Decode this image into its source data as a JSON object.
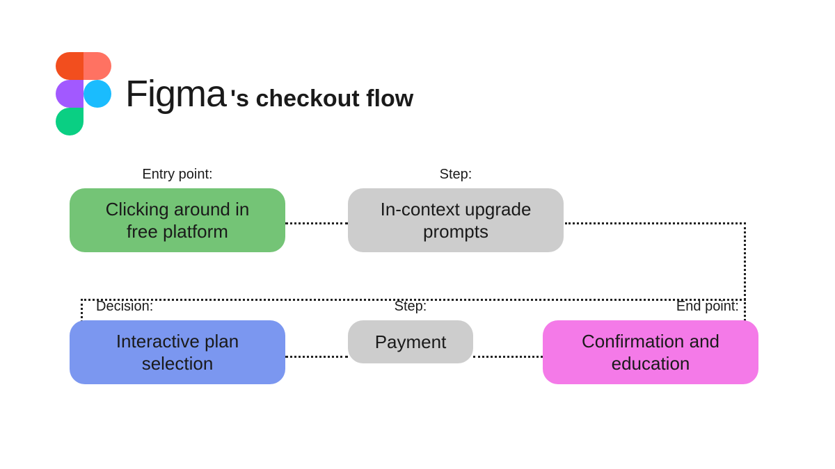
{
  "header": {
    "brand": "Figma",
    "title_suffix": "'s checkout flow"
  },
  "nodes": {
    "entry": {
      "label": "Entry point:",
      "text": "Clicking around in free platform",
      "color": "#74C476"
    },
    "step1": {
      "label": "Step:",
      "text": "In-context upgrade prompts",
      "color": "#CDCDCD"
    },
    "decision": {
      "label": "Decision:",
      "text": "Interactive plan selection",
      "color": "#7B97F0"
    },
    "step2": {
      "label": "Step:",
      "text": "Payment",
      "color": "#CDCDCD"
    },
    "end": {
      "label": "End point:",
      "text": "Confirmation and education",
      "color": "#F47AE8"
    }
  },
  "logo_colors": {
    "red_dark": "#F24E1E",
    "red_light": "#FF7262",
    "purple": "#A259FF",
    "blue": "#1ABCFE",
    "green": "#0ACF83"
  }
}
